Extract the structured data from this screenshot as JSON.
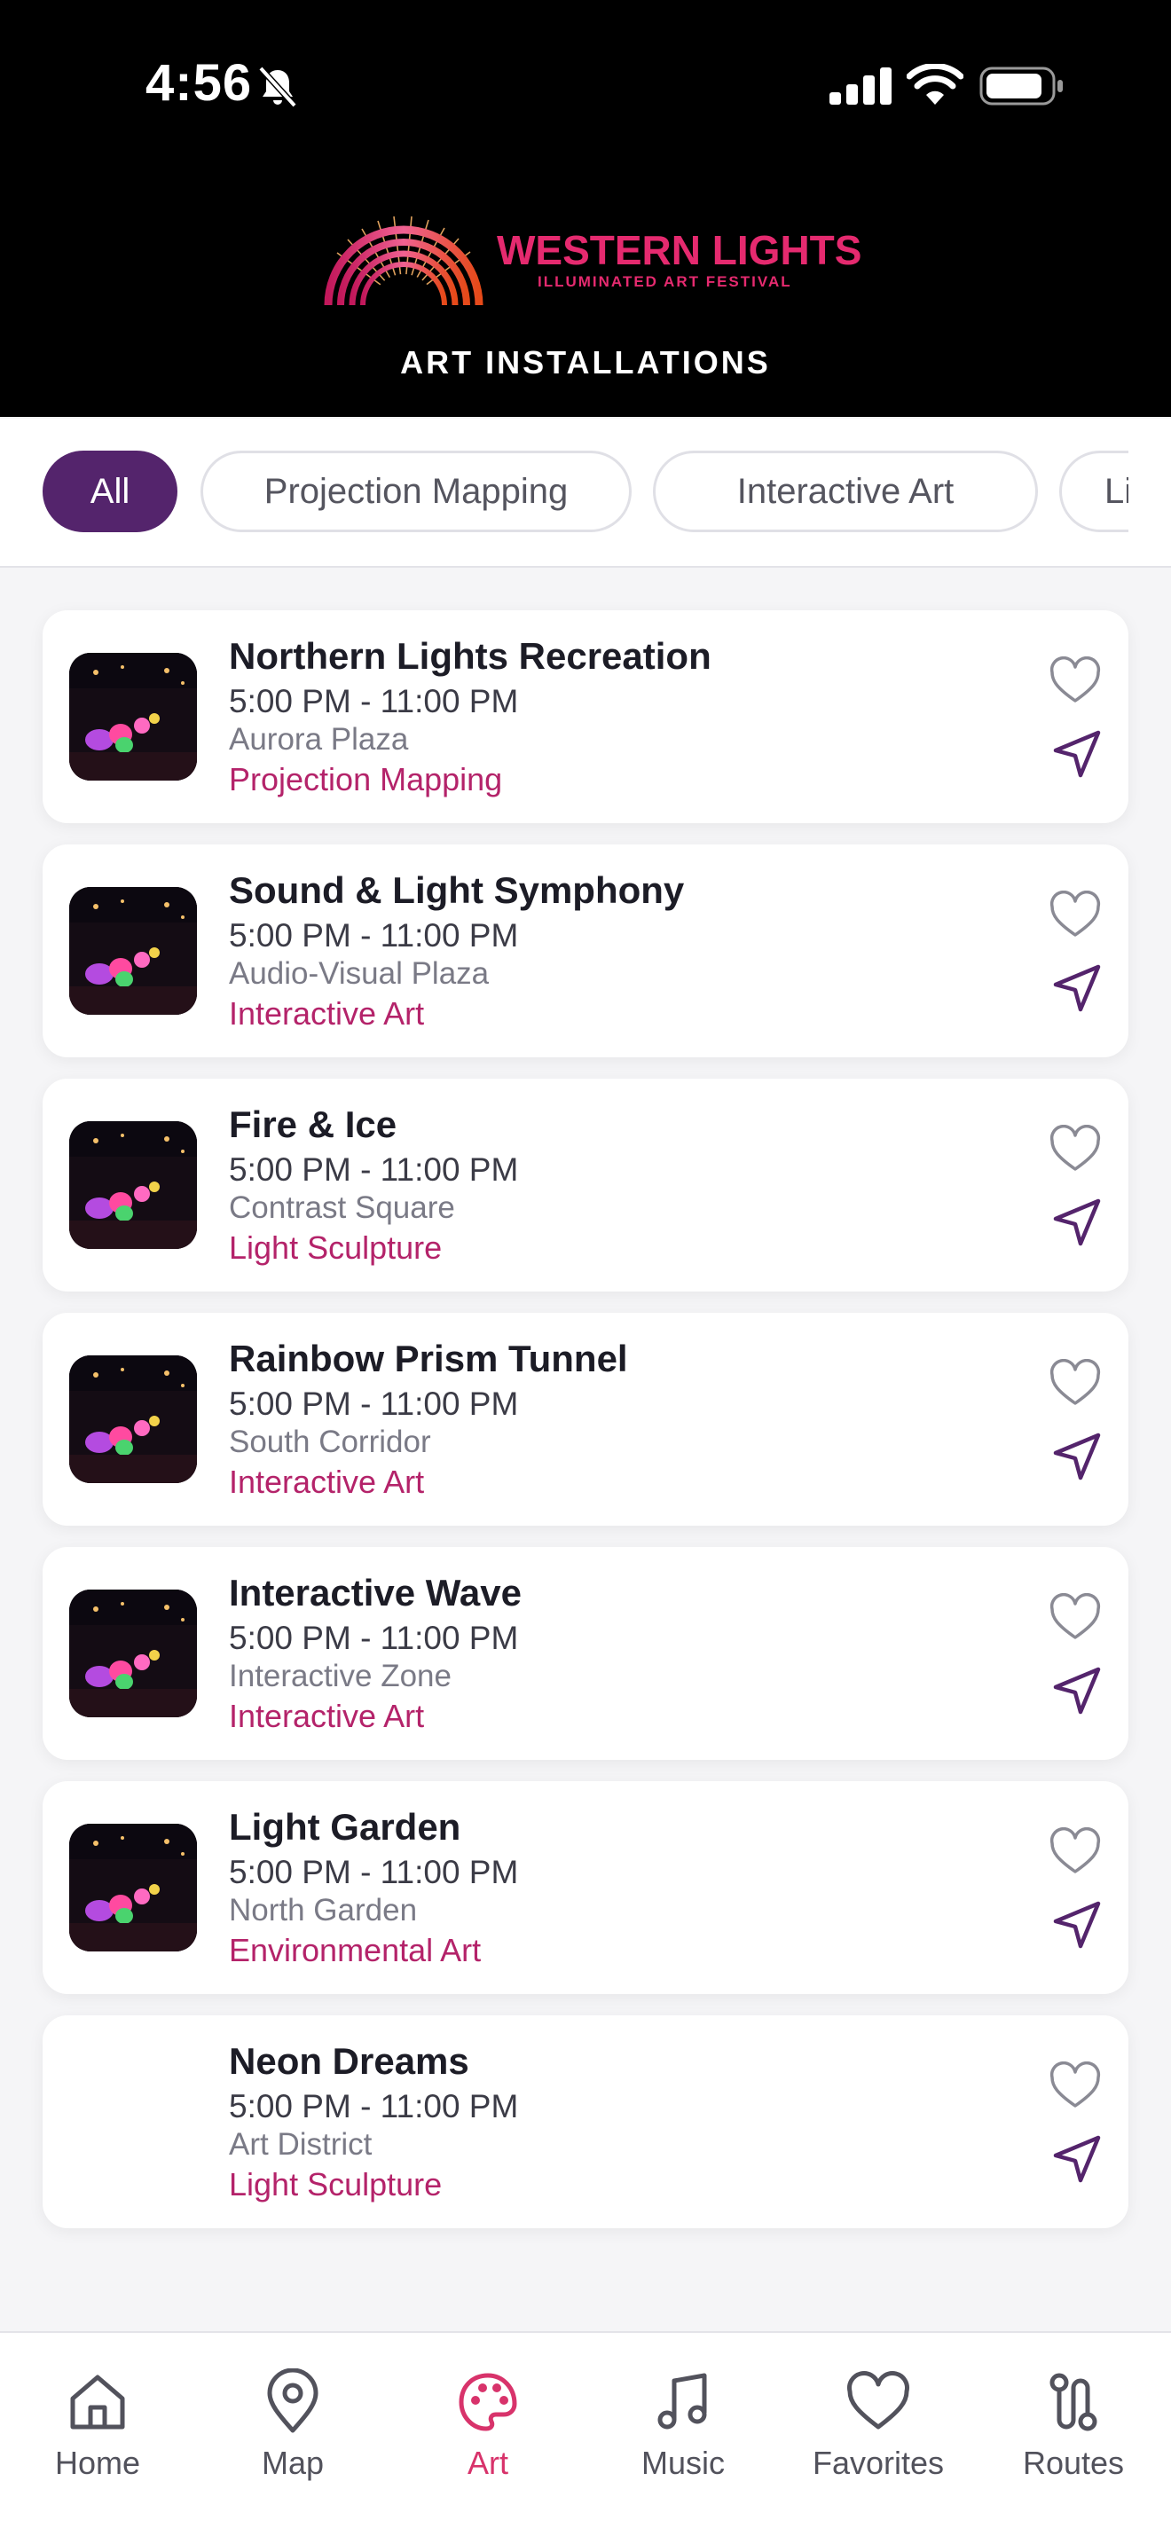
{
  "status_bar": {
    "time": "4:56"
  },
  "header": {
    "logo_title": "WESTERN LIGHTS",
    "logo_subtitle": "ILLUMINATED ART FESTIVAL",
    "page_title": "ART INSTALLATIONS"
  },
  "filters": [
    {
      "label": "All",
      "active": true
    },
    {
      "label": "Projection Mapping",
      "active": false
    },
    {
      "label": "Interactive Art",
      "active": false
    },
    {
      "label": "Ligh",
      "active": false
    }
  ],
  "installations": [
    {
      "title": "Northern Lights Recreation",
      "time": "5:00 PM - 11:00 PM",
      "location": "Aurora Plaza",
      "category": "Projection Mapping",
      "has_image": true
    },
    {
      "title": "Sound & Light Symphony",
      "time": "5:00 PM - 11:00 PM",
      "location": "Audio-Visual Plaza",
      "category": "Interactive Art",
      "has_image": true
    },
    {
      "title": "Fire & Ice",
      "time": "5:00 PM - 11:00 PM",
      "location": "Contrast Square",
      "category": "Light Sculpture",
      "has_image": true
    },
    {
      "title": "Rainbow Prism Tunnel",
      "time": "5:00 PM - 11:00 PM",
      "location": "South Corridor",
      "category": "Interactive Art",
      "has_image": true
    },
    {
      "title": "Interactive Wave",
      "time": "5:00 PM - 11:00 PM",
      "location": "Interactive Zone",
      "category": "Interactive Art",
      "has_image": true
    },
    {
      "title": "Light Garden",
      "time": "5:00 PM - 11:00 PM",
      "location": "North Garden",
      "category": "Environmental Art",
      "has_image": true
    },
    {
      "title": "Neon Dreams",
      "time": "5:00 PM - 11:00 PM",
      "location": "Art District",
      "category": "Light Sculpture",
      "has_image": false
    }
  ],
  "tabs": [
    {
      "label": "Home",
      "icon": "home-icon",
      "active": false
    },
    {
      "label": "Map",
      "icon": "map-pin-icon",
      "active": false
    },
    {
      "label": "Art",
      "icon": "palette-icon",
      "active": true
    },
    {
      "label": "Music",
      "icon": "music-note-icon",
      "active": false
    },
    {
      "label": "Favorites",
      "icon": "heart-icon",
      "active": false
    },
    {
      "label": "Routes",
      "icon": "route-icon",
      "active": false
    }
  ],
  "colors": {
    "accent_purple": "#54246c",
    "brand_pink": "#e52a6f",
    "category_magenta": "#b4236a",
    "active_tab": "#d8336b"
  }
}
